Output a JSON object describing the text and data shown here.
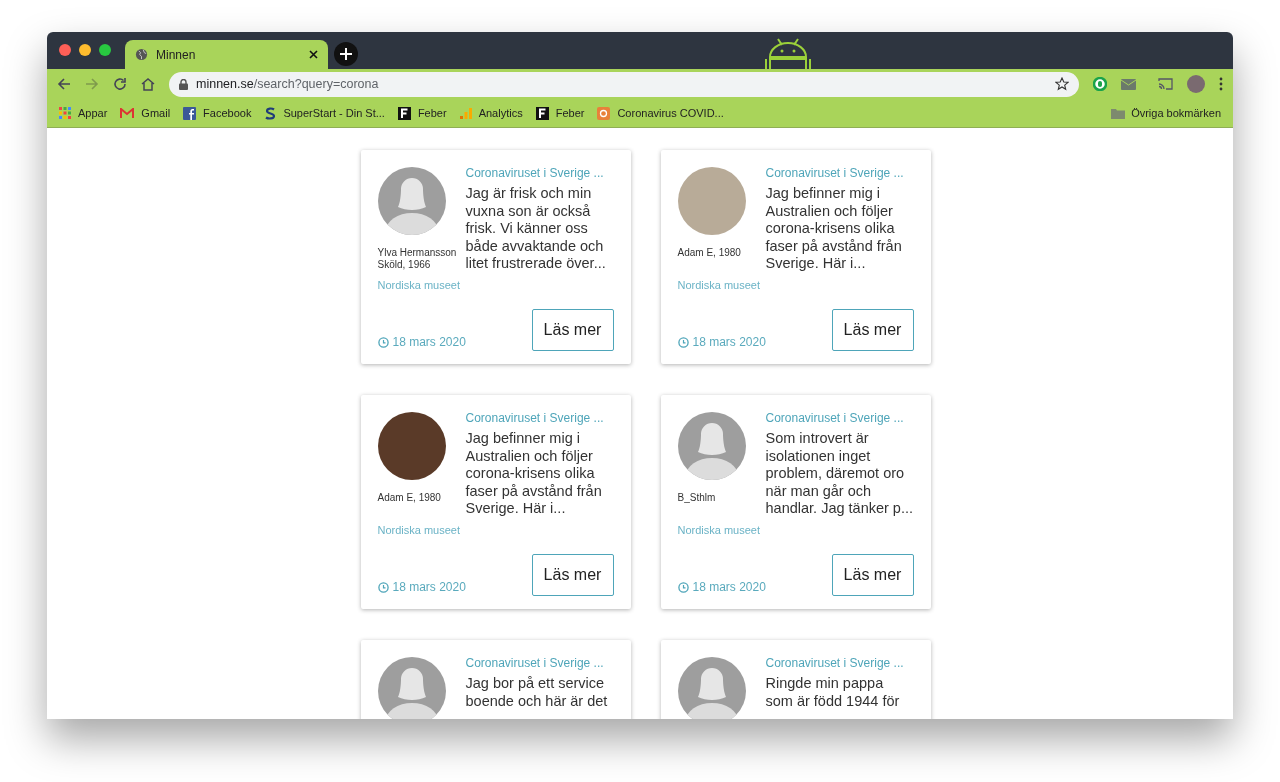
{
  "tab": {
    "title": "Minnen",
    "selected": true
  },
  "address": {
    "host": "minnen.se",
    "path": "/search?query=corona"
  },
  "nav": {
    "back_disabled": false,
    "forward_disabled": true
  },
  "bookmarks": [
    {
      "label": "Appar",
      "kind": "grid"
    },
    {
      "label": "Gmail",
      "kind": "gmail"
    },
    {
      "label": "Facebook",
      "kind": "facebook"
    },
    {
      "label": "SuperStart - Din St...",
      "kind": "s"
    },
    {
      "label": "Feber",
      "kind": "f"
    },
    {
      "label": "Analytics",
      "kind": "analytics"
    },
    {
      "label": "Feber",
      "kind": "f"
    },
    {
      "label": "Coronavirus COVID...",
      "kind": "covid"
    }
  ],
  "other_bookmarks": "Övriga bokmärken",
  "cards": [
    {
      "kind": "silhouette",
      "author": "Ylva Hermansson Sköld, 1966",
      "title": "Coronaviruset i Sverige ...",
      "text": "Jag är frisk och min vuxna son är också frisk. Vi känner oss både avvaktande och litet frustrerade över...",
      "source": "Nordiska museet",
      "date": "18 mars 2020",
      "button": "Läs mer"
    },
    {
      "kind": "photo",
      "author": "Adam E, 1980",
      "title": "Coronaviruset i Sverige ...",
      "text": "Jag befinner mig i Australien och följer corona-krisens olika faser på avstånd från Sverige. Här i...",
      "source": "Nordiska museet",
      "date": "18 mars 2020",
      "button": "Läs mer"
    },
    {
      "kind": "photo",
      "author": "Adam E, 1980",
      "title": "Coronaviruset i Sverige ...",
      "text": "Jag befinner mig i Australien och följer corona-krisens olika faser på avstånd från Sverige. Här i...",
      "source": "Nordiska museet",
      "date": "18 mars 2020",
      "button": "Läs mer"
    },
    {
      "kind": "silhouette",
      "author": "B_Sthlm",
      "title": "Coronaviruset i Sverige ...",
      "text": "Som introvert är isolationen inget problem, däremot oro när man går och handlar. Jag tänker p...",
      "source": "Nordiska museet",
      "date": "18 mars 2020",
      "button": "Läs mer"
    },
    {
      "kind": "silhouette",
      "title": "Coronaviruset i Sverige ...",
      "text": "Jag bor på ett service boende och här är det"
    },
    {
      "kind": "silhouette",
      "title": "Coronaviruset i Sverige ...",
      "text": "Ringde min pappa som är född 1944 för"
    }
  ]
}
